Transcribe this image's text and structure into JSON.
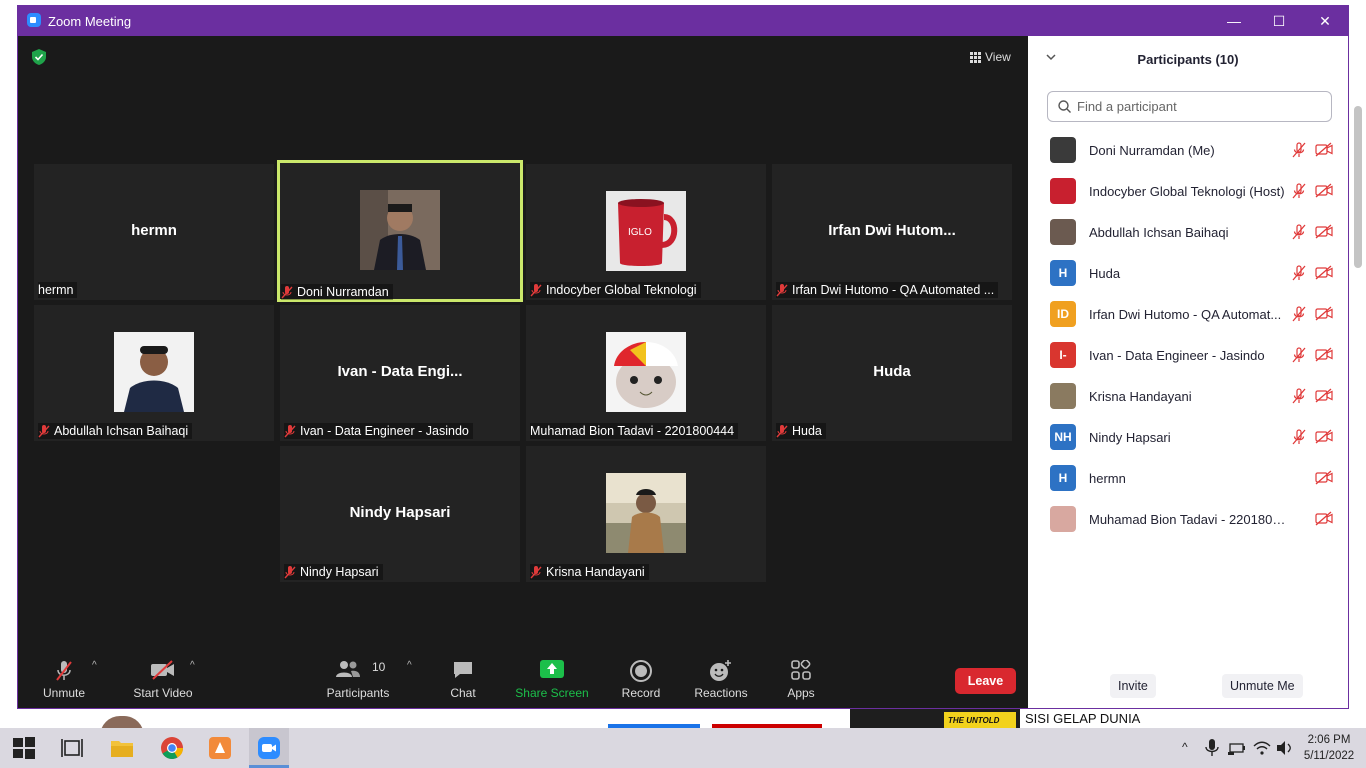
{
  "window": {
    "title": "Zoom Meeting",
    "minimize": "—",
    "maximize": "☐",
    "close": "✕"
  },
  "meeting": {
    "view_label": "View",
    "tiles": [
      {
        "display": "hermn",
        "label": "hermn",
        "muted": false
      },
      {
        "display": "",
        "label": "Doni Nurramdan",
        "muted": true
      },
      {
        "display": "",
        "label": "Indocyber Global Teknologi",
        "muted": true
      },
      {
        "display": "Irfan Dwi Hutom...",
        "label": "Irfan Dwi Hutomo - QA Automated ...",
        "muted": true
      },
      {
        "display": "",
        "label": "Abdullah Ichsan Baihaqi",
        "muted": true
      },
      {
        "display": "Ivan - Data Engi...",
        "label": "Ivan - Data Engineer - Jasindo",
        "muted": true
      },
      {
        "display": "",
        "label": "Muhamad Bion Tadavi - 2201800444",
        "muted": false
      },
      {
        "display": "Huda",
        "label": "Huda",
        "muted": true
      },
      {
        "display": "Nindy Hapsari",
        "label": "Nindy Hapsari",
        "muted": true
      },
      {
        "display": "",
        "label": "Krisna Handayani",
        "muted": true
      }
    ]
  },
  "toolbar": {
    "unmute": "Unmute",
    "start_video": "Start Video",
    "participants": "Participants",
    "participants_count": "10",
    "chat": "Chat",
    "share_screen": "Share Screen",
    "record": "Record",
    "reactions": "Reactions",
    "apps": "Apps",
    "leave": "Leave"
  },
  "panel": {
    "title": "Participants (10)",
    "search_placeholder": "Find a participant",
    "participants": [
      {
        "name": "Doni Nurramdan (Me)",
        "avatar": "",
        "color": "#3a3a3a",
        "mic_muted": true
      },
      {
        "name": "Indocyber Global Teknologi (Host)",
        "avatar": "",
        "color": "#c8202f",
        "mic_muted": true
      },
      {
        "name": "Abdullah Ichsan Baihaqi",
        "avatar": "",
        "color": "#6b5a50",
        "mic_muted": true
      },
      {
        "name": "Huda",
        "avatar": "H",
        "color": "#2d72c4",
        "mic_muted": true
      },
      {
        "name": "Irfan Dwi Hutomo - QA Automat...",
        "avatar": "ID",
        "color": "#f0a020",
        "mic_muted": true
      },
      {
        "name": "Ivan - Data Engineer - Jasindo",
        "avatar": "I-",
        "color": "#d9362f",
        "mic_muted": true
      },
      {
        "name": "Krisna Handayani",
        "avatar": "",
        "color": "#8a7a60",
        "mic_muted": true
      },
      {
        "name": "Nindy Hapsari",
        "avatar": "NH",
        "color": "#2d72c4",
        "mic_muted": true
      },
      {
        "name": "hermn",
        "avatar": "H",
        "color": "#2d72c4",
        "mic_muted": false
      },
      {
        "name": "Muhamad Bion Tadavi - 2201800444",
        "avatar": "",
        "color": "#d8a8a0",
        "mic_muted": false
      }
    ],
    "invite": "Invite",
    "unmute_me": "Unmute Me"
  },
  "desktop": {
    "news_tag": "THE UNTOLD",
    "news_headline": "SISI GELAP DUNIA"
  },
  "taskbar": {
    "time": "2:06 PM",
    "date": "5/11/2022"
  },
  "colors": {
    "titlebar": "#6b2fa0",
    "leave": "#d9282f",
    "share": "#1cbf4a",
    "active_border": "#cbe86b"
  }
}
